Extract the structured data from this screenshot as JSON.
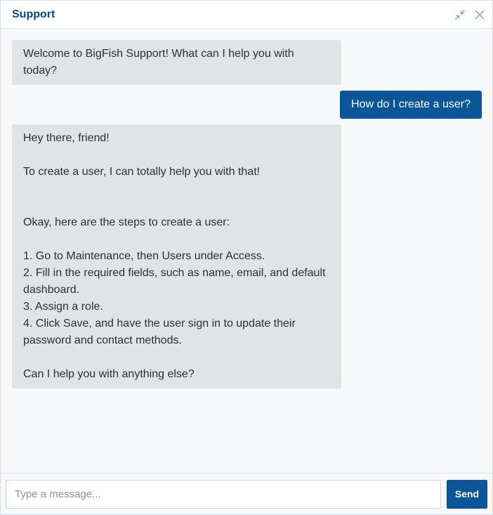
{
  "header": {
    "title": "Support",
    "minimize_icon": "collapse-arrows-icon",
    "close_icon": "close-icon"
  },
  "messages": [
    {
      "from": "bot",
      "text": "Welcome to BigFish Support! What can I help you with today?"
    },
    {
      "from": "user",
      "text": "How do I create a user?"
    },
    {
      "from": "bot",
      "text": "Hey there, friend!\n\nTo create a user, I can totally help you with that!\n\n\nOkay, here are the steps to create a user:\n\n1. Go to Maintenance, then Users under Access.\n2. Fill in the required fields, such as name, email, and default dashboard.\n3. Assign a role.\n4. Click Save, and have the user sign in to update their password and contact methods.\n\nCan I help you with anything else?"
    }
  ],
  "composer": {
    "placeholder": "Type a message...",
    "value": "",
    "send_label": "Send"
  },
  "colors": {
    "accent": "#0a5698",
    "title": "#0b4a85",
    "bot_bubble": "#e1e3e6",
    "background": "#f6f8fa"
  }
}
